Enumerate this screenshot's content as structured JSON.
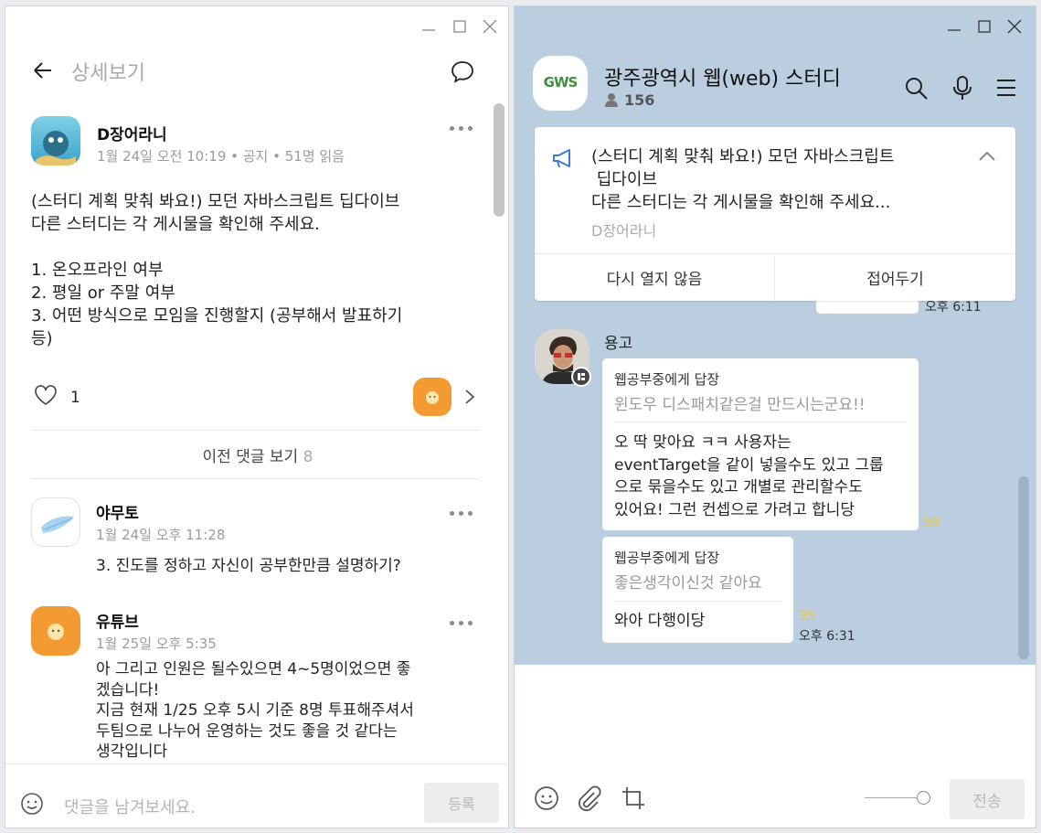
{
  "left": {
    "header": {
      "title": "상세보기"
    },
    "post": {
      "author": "D장어라니",
      "meta": "1월 24일 오전 10:19 • 공지 • 51명 읽음",
      "lines": [
        "(스터디 계획 맞춰 봐요!) 모던 자바스크립트 딥다이브",
        "다른 스터디는 각 게시물을 확인해 주세요.",
        "",
        "1. 온오프라인 여부",
        "2. 평일 or 주말 여부",
        "3. 어떤 방식으로 모임을 진행할지 (공부해서 발표하기",
        "등)"
      ],
      "like_count": "1"
    },
    "prev_comments": {
      "label": "이전 댓글 보기",
      "count": "8"
    },
    "comments": [
      {
        "author": "야무토",
        "time": "1월 24일 오후 11:28",
        "lines": [
          "3. 진도를 정하고 자신이 공부한만큼 설명하기?"
        ]
      },
      {
        "author": "유튜브",
        "time": "1월 25일 오후 5:35",
        "lines": [
          "아 그리고 인원은 될수있으면 4~5명이었으면 좋",
          "겠습니다!",
          "지금 현재 1/25 오후 5시 기준 8명 투표해주셔서",
          "두팀으로 나누어 운영하는 것도 좋을 것 같다는",
          "생각입니다"
        ]
      }
    ],
    "input": {
      "placeholder": "댓글을 남겨보세요.",
      "submit": "등록"
    }
  },
  "right": {
    "room": {
      "name": "광주광역시 웹(web) 스터디",
      "members": "156",
      "logo_text": "GWS"
    },
    "notice": {
      "lines": [
        "(스터디 계획 맞춰 봐요!) 모던 자바스크립트",
        " 딥다이브",
        "다른 스터디는 각 게시물을 확인해 주세요..."
      ],
      "author": "D장어라니",
      "btn_hide": "다시 열지 않음",
      "btn_fold": "접어두기"
    },
    "behind_time": "오후 6:11",
    "sender": "용고",
    "messages": [
      {
        "reply_to": "웹공부중에게 답장",
        "quote": "윈도우 디스패치같은걸 만드시는군요!!",
        "lines": [
          "오 딱 맞아요 ㅋㅋ 사용자는",
          "eventTarget을 같이 넣을수도 있고 그룹",
          "으로 묶을수도 있고 개별로 관리할수도",
          "있어요! 그런 컨셉으로 가려고 합니당"
        ],
        "count": "99"
      },
      {
        "reply_to": "웹공부중에게 답장",
        "quote": "좋은생각이신것 같아요",
        "lines": [
          "와아 다행이당"
        ],
        "count": "99",
        "time": "오후 6:31"
      }
    ],
    "input": {
      "send": "전송"
    }
  },
  "colors": {
    "chat_bg": "#bacee0",
    "accent_orange": "#f39a32",
    "read_count": "#e9c94b"
  },
  "icons": [
    "back-arrow-icon",
    "chat-bubble-icon",
    "more-dots-icon",
    "heart-icon",
    "chevron-right-icon",
    "emoji-icon",
    "search-icon",
    "microphone-icon",
    "menu-icon",
    "megaphone-icon",
    "chevron-up-icon",
    "paperclip-icon",
    "crop-icon",
    "person-icon"
  ]
}
